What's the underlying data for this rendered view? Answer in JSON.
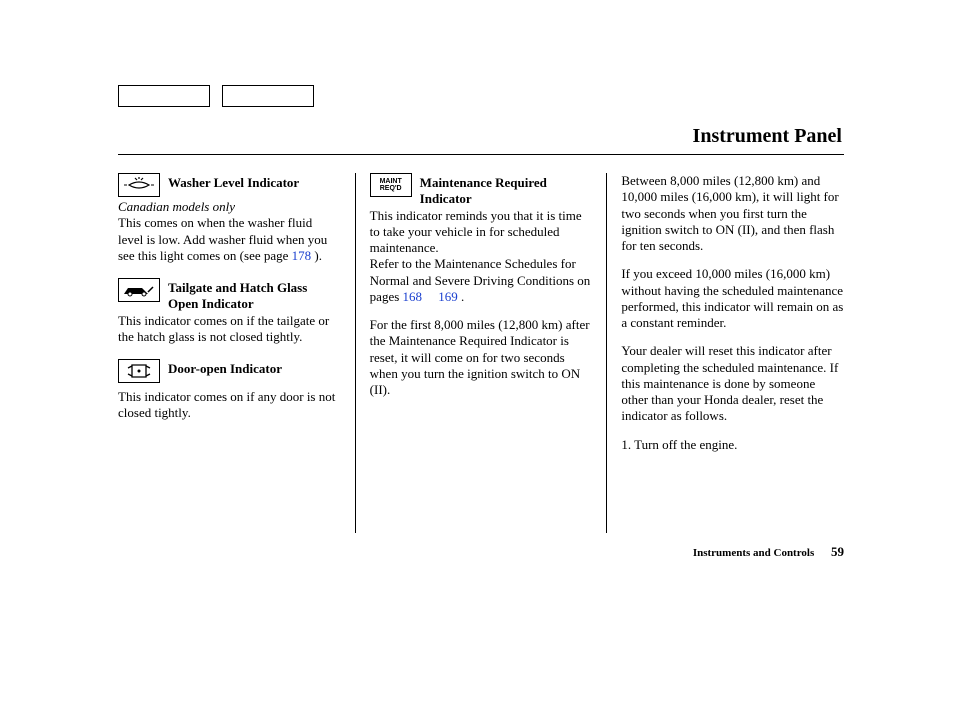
{
  "page_title": "Instrument Panel",
  "footer_section": "Instruments and Controls",
  "footer_page": "59",
  "col1": {
    "washer": {
      "title": "Washer Level Indicator",
      "note": "Canadian models only",
      "body_a": "This comes on when the washer fluid level is low. Add washer fluid when you see this light comes on (see page ",
      "link1": "178",
      "body_b": " )."
    },
    "tailgate": {
      "title": "Tailgate and Hatch Glass Open Indicator",
      "body": "This indicator comes on if the tailgate or the hatch glass is not closed tightly."
    },
    "door": {
      "title": "Door-open Indicator",
      "body": "This indicator comes on if any door is not closed tightly."
    }
  },
  "col2": {
    "maint": {
      "icon_line1": "MAINT",
      "icon_line2": "REQ'D",
      "title": "Maintenance Required Indicator",
      "body_a": "This indicator reminds you that it is time to take your vehicle in for scheduled maintenance.",
      "body_b": "Refer to the Maintenance Schedules for Normal and Severe Driving Conditions on pages ",
      "link1": "168",
      "body_c": "     ",
      "link2": "169",
      "body_d": " .",
      "body_e": "For the first 8,000 miles (12,800 km) after the Maintenance Required Indicator is reset, it will come on for two seconds when you turn the ignition switch to ON (II)."
    }
  },
  "col3": {
    "p1": "Between 8,000 miles (12,800 km) and 10,000 miles (16,000 km), it will light for two seconds when you first turn the ignition switch to ON (II), and then flash for ten seconds.",
    "p2": "If you exceed 10,000 miles (16,000 km) without having the scheduled maintenance performed, this indicator will remain on as a constant reminder.",
    "p3": "Your dealer will reset this indicator after completing the scheduled maintenance. If this maintenance is done by someone other than your Honda dealer, reset the indicator as follows.",
    "p4": "1. Turn off the engine."
  }
}
